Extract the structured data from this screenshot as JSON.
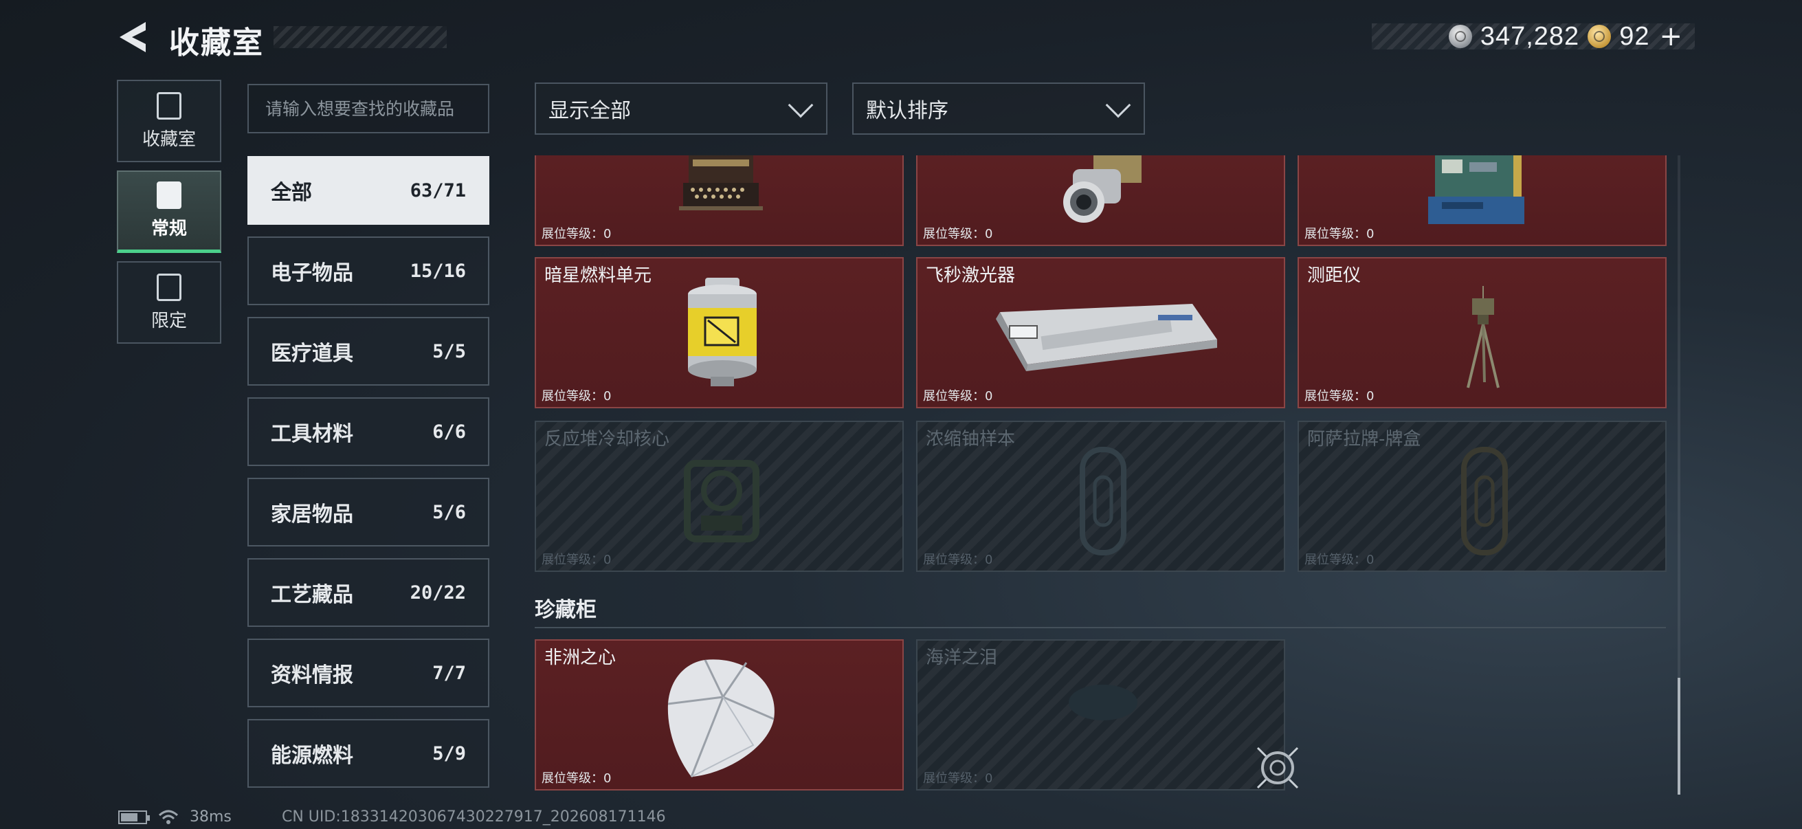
{
  "header": {
    "title": "收藏室",
    "currency": {
      "silver": "347,282",
      "gold": "92",
      "plus": "+"
    }
  },
  "side_nav": [
    {
      "label": "收藏室",
      "icon": "collection-icon"
    },
    {
      "label": "常规",
      "icon": "regular-icon"
    },
    {
      "label": "限定",
      "icon": "limited-icon"
    }
  ],
  "search": {
    "placeholder": "请输入想要查找的收藏品"
  },
  "categories": [
    {
      "name": "全部",
      "count": "63/71"
    },
    {
      "name": "电子物品",
      "count": "15/16"
    },
    {
      "name": "医疗道具",
      "count": "5/5"
    },
    {
      "name": "工具材料",
      "count": "6/6"
    },
    {
      "name": "家居物品",
      "count": "5/6"
    },
    {
      "name": "工艺藏品",
      "count": "20/22"
    },
    {
      "name": "资料情报",
      "count": "7/7"
    },
    {
      "name": "能源燃料",
      "count": "5/9"
    }
  ],
  "filters": {
    "show": "显示全部",
    "sort": "默认排序"
  },
  "items": [
    {
      "name": "",
      "level": "展位等级：0",
      "state": "owned",
      "icon": "typewriter-icon"
    },
    {
      "name": "",
      "level": "展位等级：0",
      "state": "owned",
      "icon": "laser-lens-icon"
    },
    {
      "name": "",
      "level": "展位等级：0",
      "state": "owned",
      "icon": "circuit-device-icon"
    },
    {
      "name": "暗星燃料单元",
      "level": "展位等级：0",
      "state": "owned",
      "icon": "fuel-canister-icon"
    },
    {
      "name": "飞秒激光器",
      "level": "展位等级：0",
      "state": "owned",
      "icon": "femtosecond-laser-icon"
    },
    {
      "name": "测距仪",
      "level": "展位等级：0",
      "state": "owned",
      "icon": "rangefinder-tripod-icon"
    },
    {
      "name": "反应堆冷却核心",
      "level": "展位等级：0",
      "state": "locked",
      "icon": "reactor-core-icon"
    },
    {
      "name": "浓缩铀样本",
      "level": "展位等级：0",
      "state": "locked",
      "icon": "uranium-sample-icon"
    },
    {
      "name": "阿萨拉牌-牌盒",
      "level": "展位等级：0",
      "state": "locked",
      "icon": "card-box-icon"
    }
  ],
  "treasure": {
    "title": "珍藏柜",
    "items": [
      {
        "name": "非洲之心",
        "level": "展位等级：0",
        "state": "owned",
        "icon": "diamond-icon"
      },
      {
        "name": "海洋之泪",
        "level": "展位等级：0",
        "state": "locked",
        "icon": "ocean-tear-icon"
      }
    ]
  },
  "status": {
    "ping": "38ms",
    "battery_level": 0.7,
    "uid": "CN UID:18331420306743022791​7_202608171146"
  }
}
